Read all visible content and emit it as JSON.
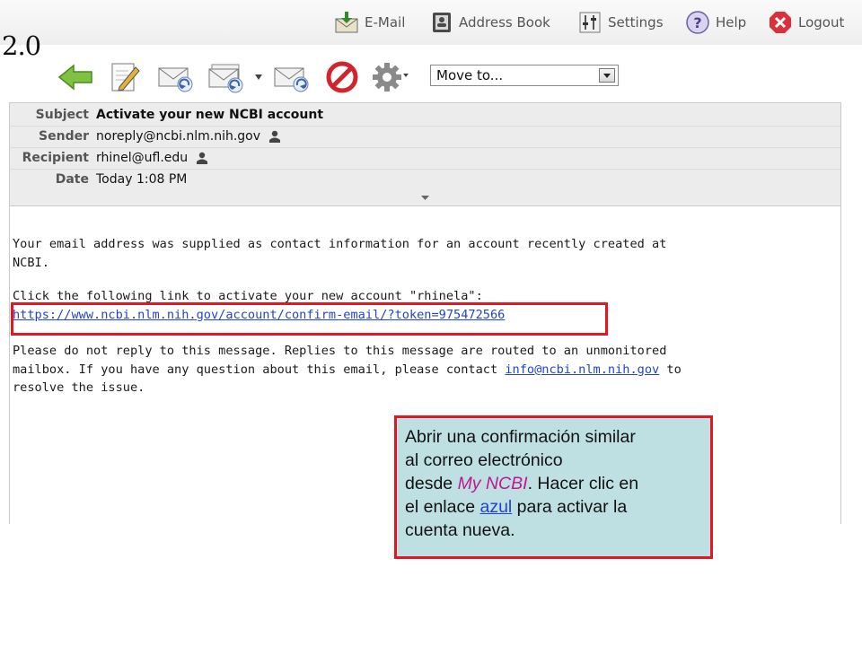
{
  "brand": {
    "version": "2.0"
  },
  "nav": {
    "email": "E-Mail",
    "address_book": "Address Book",
    "settings": "Settings",
    "help": "Help",
    "logout": "Logout"
  },
  "toolbar": {
    "icons": [
      "back-arrow-icon",
      "compose-icon",
      "reply-icon",
      "reply-all-icon",
      "forward-icon",
      "delete-icon",
      "gear-icon"
    ],
    "move_to": "Move to..."
  },
  "message": {
    "headers": [
      {
        "label": "Subject",
        "value": "Activate your new NCBI account"
      },
      {
        "label": "Sender",
        "value": "noreply@ncbi.nlm.nih.gov"
      },
      {
        "label": "Recipient",
        "value": "rhinel@ufl.edu"
      },
      {
        "label": "Date",
        "value": "Today 1:08 PM"
      }
    ],
    "body": {
      "para1_line1": "Your email address was supplied as contact information for an account recently created at",
      "para1_line2": "NCBI.",
      "para2_line1": "Click the following link to activate your new account \"rhinela\":",
      "activation_link": "https://www.ncbi.nlm.nih.gov/account/confirm-email/?token=975472566",
      "para3_line1": "Please do not reply to this message. Replies to this message are routed to an unmonitored",
      "para3_line2_prefix": "mailbox. If you have any question about this email, please contact ",
      "contact_link": "info@ncbi.nlm.nih.gov",
      "para3_line2_suffix": " to",
      "para3_line3": "resolve the issue."
    }
  },
  "callout": {
    "line1": "Abrir una confirmación similar",
    "line2": "al correo electrónico",
    "line3_prefix": "desde ",
    "line3_highlight": "My NCBI",
    "line3_suffix": ". Hacer clic en",
    "line4_prefix": "el enlace ",
    "line4_link": "azul",
    "line4_suffix": " para activar la",
    "line5": "cuenta nueva."
  },
  "colors": {
    "accent_red": "#e1181f",
    "callout_bg": "#bfe0e3",
    "link_blue": "#2244cc",
    "highlight_magenta": "#c0178f"
  }
}
